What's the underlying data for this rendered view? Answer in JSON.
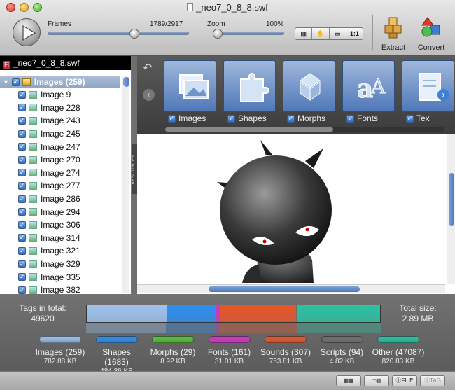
{
  "window": {
    "title": "_neo7_0_8_8.swf"
  },
  "toolbar": {
    "frames_label": "Frames",
    "frames_counter": "1789/2917",
    "frames_progress": 0.613,
    "zoom_label": "Zoom",
    "zoom_value": "100%",
    "zoom_level": 0.0,
    "fit_label": "1:1",
    "extract_label": "Extract",
    "convert_label": "Convert"
  },
  "sidebar": {
    "file_badge": "Fl",
    "file_name": "_neo7_0_8_8.swf",
    "root_label": "Images (259)",
    "items": [
      "Image 9",
      "Image 228",
      "Image 243",
      "Image 245",
      "Image 247",
      "Image 270",
      "Image 274",
      "Image 277",
      "Image 286",
      "Image 294",
      "Image 306",
      "Image 314",
      "Image 321",
      "Image 329",
      "Image 335",
      "Image 382"
    ],
    "resources_tab": "RESOURCES"
  },
  "strip": {
    "categories": [
      {
        "label": "Images"
      },
      {
        "label": "Shapes"
      },
      {
        "label": "Morphs"
      },
      {
        "label": "Fonts"
      },
      {
        "label": "Tex"
      }
    ]
  },
  "stats": {
    "tags_label": "Tags in total:",
    "tags_value": "49620",
    "size_label": "Total size:",
    "size_value": "2.89 MB",
    "segments": [
      {
        "name": "Images",
        "count": 259,
        "label": "Images (259)",
        "size": "782.88 KB",
        "color": "#9fc3ee"
      },
      {
        "name": "Shapes",
        "count": 1683,
        "label": "Shapes (1683)",
        "size": "484.36 KB",
        "color": "#2d8ef0"
      },
      {
        "name": "Morphs",
        "count": 29,
        "label": "Morphs (29)",
        "size": "8.92 KB",
        "color": "#57c43a"
      },
      {
        "name": "Fonts",
        "count": 161,
        "label": "Fonts (161)",
        "size": "31.01 KB",
        "color": "#d236c9"
      },
      {
        "name": "Sounds",
        "count": 307,
        "label": "Sounds (307)",
        "size": "753.81 KB",
        "color": "#e8562a"
      },
      {
        "name": "Scripts",
        "count": 94,
        "label": "Scripts (94)",
        "size": "4.82 KB",
        "color": "#6e6e6e"
      },
      {
        "name": "Other",
        "count": 47087,
        "label": "Other (47087)",
        "size": "820.83 KB",
        "color": "#2bc2a3"
      }
    ]
  },
  "statusbar": {
    "file_label": "FILE",
    "tag_label": "TAG"
  }
}
